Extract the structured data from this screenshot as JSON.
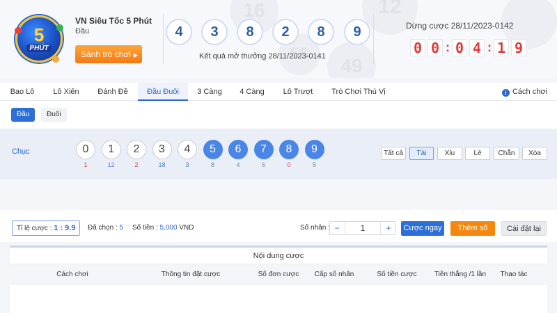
{
  "header": {
    "logo": {
      "number": "5",
      "word": "PHÚT"
    },
    "game_title": "VN Siêu Tốc 5 Phút",
    "game_subtitle": "Đầu",
    "lobby_button": "Sảnh trò chơi",
    "result_numbers": [
      "4",
      "3",
      "8",
      "2",
      "8",
      "9"
    ],
    "result_caption": "Kết quả mở thưởng 28/11/2023-0141",
    "stop_caption": "Dừng cược 28/11/2023-0142",
    "countdown": [
      "0",
      "0",
      ":",
      "0",
      "4",
      ":",
      "1",
      "9"
    ]
  },
  "tabs": [
    {
      "label": "Bao Lô",
      "active": false
    },
    {
      "label": "Lô Xiên",
      "active": false
    },
    {
      "label": "Đánh Đề",
      "active": false
    },
    {
      "label": "Đầu Đuôi",
      "active": true
    },
    {
      "label": "3 Càng",
      "active": false
    },
    {
      "label": "4 Càng",
      "active": false
    },
    {
      "label": "Lô Trượt",
      "active": false
    },
    {
      "label": "Trò Chơi Thú Vị",
      "active": false
    }
  ],
  "help": {
    "label": "Cách chơi"
  },
  "subtabs": [
    {
      "label": "Đầu",
      "active": true
    },
    {
      "label": "Đuôi",
      "active": false
    }
  ],
  "panel": {
    "row_label": "Chục",
    "numbers": [
      {
        "n": "0",
        "count": "1",
        "selected": false
      },
      {
        "n": "1",
        "count": "12",
        "selected": false
      },
      {
        "n": "2",
        "count": "2",
        "selected": false
      },
      {
        "n": "3",
        "count": "18",
        "selected": false
      },
      {
        "n": "4",
        "count": "3",
        "selected": false
      },
      {
        "n": "5",
        "count": "8",
        "selected": true
      },
      {
        "n": "6",
        "count": "4",
        "selected": true
      },
      {
        "n": "7",
        "count": "6",
        "selected": true
      },
      {
        "n": "8",
        "count": "0",
        "selected": true
      },
      {
        "n": "9",
        "count": "5",
        "selected": true
      }
    ],
    "filters": [
      {
        "label": "Tất cả",
        "selected": false
      },
      {
        "label": "Tài",
        "selected": true
      },
      {
        "label": "Xỉu",
        "selected": false
      },
      {
        "label": "Lẻ",
        "selected": false
      },
      {
        "label": "Chẵn",
        "selected": false
      },
      {
        "label": "Xóa",
        "selected": false
      }
    ]
  },
  "betbar": {
    "ratio_label": "Tỉ lệ cược :",
    "ratio_value": "1 : 9.9",
    "chosen_label": "Đã chọn :",
    "chosen_value": "5",
    "amount_label": "Số tiền :",
    "amount_value": "5,000",
    "amount_unit": "VND",
    "multiplier_label": "Số nhân :",
    "multiplier_value": "1",
    "minus": "−",
    "plus": "+",
    "bet_now": "Cược ngay",
    "add_number": "Thêm số",
    "reset": "Cài đặt lại"
  },
  "table": {
    "title": "Nội dung cược",
    "headers": [
      "Cách chơi",
      "Thông tin đặt cược",
      "Số đơn cược",
      "Cấp số nhân",
      "Số tiền cược",
      "Tiền thắng /1 lần",
      "Thao tác"
    ]
  },
  "colors": {
    "accent_blue": "#2c6fd6",
    "accent_orange": "#f5870f",
    "countdown_red": "#e03a3a",
    "count_red": "#e03a3a",
    "count_blue": "#4a7fcf"
  }
}
